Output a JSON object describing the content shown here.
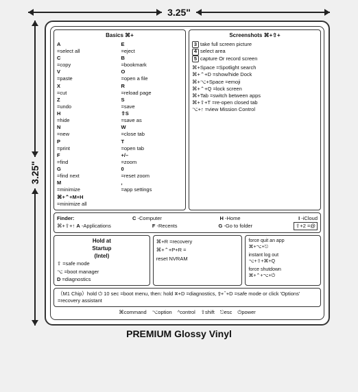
{
  "dimensions": {
    "width": "3.25\"",
    "height": "3.25\""
  },
  "basics": {
    "title": "Basics ⌘+",
    "items": [
      {
        "key": "A",
        "desc": "=select all"
      },
      {
        "key": "E",
        "desc": "=eject"
      },
      {
        "key": "C",
        "desc": "=copy"
      },
      {
        "key": "B",
        "desc": "=bookmark"
      },
      {
        "key": "V",
        "desc": "=paste"
      },
      {
        "key": "O",
        "desc": "=open a file"
      },
      {
        "key": "X",
        "desc": "=cut"
      },
      {
        "key": "R",
        "desc": "=reload page"
      },
      {
        "key": "Z",
        "desc": "=undo"
      },
      {
        "key": "S",
        "desc": "=save"
      },
      {
        "key": "H",
        "desc": "=hide"
      },
      {
        "key": "⇧S",
        "desc": "=save as"
      },
      {
        "key": "N",
        "desc": "=new"
      },
      {
        "key": "W",
        "desc": "=close tab"
      },
      {
        "key": "P",
        "desc": "=print"
      },
      {
        "key": "T",
        "desc": "=open tab"
      },
      {
        "key": "F",
        "desc": "=find"
      },
      {
        "key": "+/–",
        "desc": "=zoom"
      },
      {
        "key": "G",
        "desc": "=find next"
      },
      {
        "key": "0",
        "desc": "=reset zoom"
      },
      {
        "key": "M",
        "desc": "=minimize"
      },
      {
        "key": ",",
        "desc": "=app settings"
      },
      {
        "key": "⌘+⌃+M+H",
        "desc": "=minimize all",
        "full_width": true
      }
    ]
  },
  "screenshots": {
    "title": "Screenshots ⌘+⇧+",
    "items": [
      {
        "num": "3",
        "desc": "take full screen picture"
      },
      {
        "num": "4",
        "desc": "select area"
      },
      {
        "num": "5",
        "desc": "capture or record screen"
      }
    ]
  },
  "shortcuts": [
    "⌘+Space =Spotlight search",
    "⌘+⌃+D =show/hide Dock",
    "⌘+⌥+Space =emoji",
    "⌘+⌃+Q =lock screen",
    "⌘+Tab =switch between apps",
    "⌘+⇧+T =re-open closed tab",
    "⌥+↑ =view Mission Control"
  ],
  "finder": {
    "label": "Finder:",
    "keys": [
      {
        "key": "C",
        "desc": "Computer"
      },
      {
        "key": "H",
        "desc": "Home"
      },
      {
        "key": "I",
        "desc": "iCloud"
      },
      {
        "key": "⌘+⇧+↑",
        "desc": "A-Applications"
      },
      {
        "key": "F",
        "desc": "Recents"
      },
      {
        "key": "G",
        "desc": "Go to folder"
      },
      {
        "key": "⇧+2",
        "desc": "@",
        "right": true
      }
    ]
  },
  "startup": {
    "title": "Hold at Startup (Intel)",
    "items": [
      {
        "icon": "⇧",
        "desc": "safe mode"
      },
      {
        "icon": "⌥",
        "desc": "boot manager"
      },
      {
        "icon": "D",
        "desc": "diagnostics"
      }
    ]
  },
  "nvram": {
    "items": [
      "⌘+R =recovery",
      "⌘+⌃+P+R =reset NVRAM"
    ]
  },
  "force": {
    "quit_title": "force quit an app",
    "quit_keys": "⌘+⌥+⎋",
    "logout_title": "instant log out",
    "logout_keys": "⌥+⇧+⌘+Q",
    "shutdown_title": "force shutdown",
    "shutdown_keys": "⌘+⌃+⌥+⏻"
  },
  "m1": "（M1 Chip）hold ⏻ 10 sec =boot menu, then: hold ⌘+D =diagnostics, ⇧+⌃+D =safe mode or click 'Options' =recovery assistant",
  "legend": [
    "⌘ command",
    "⌥ option",
    "^ control",
    "⇧ shift",
    "⎋ esc",
    "⏻ power"
  ],
  "footer": "PREMIUM Glossy Vinyl"
}
